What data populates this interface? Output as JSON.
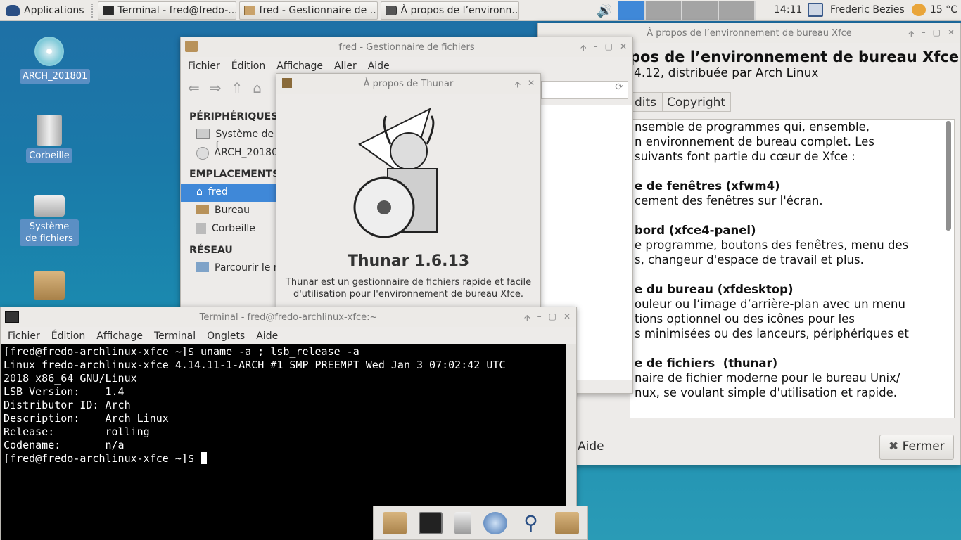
{
  "panel": {
    "applications_label": "Applications",
    "tasks": [
      {
        "label": "Terminal - fred@fredo-..."
      },
      {
        "label": "fred - Gestionnaire de ..."
      },
      {
        "label": "À propos de l’environn..."
      }
    ],
    "clock": "14:11",
    "user": "Frederic Bezies",
    "weather": "15 °C"
  },
  "desktop": {
    "icons": [
      {
        "label": "ARCH_201801"
      },
      {
        "label": "Corbeille"
      },
      {
        "label": "Système de fichiers"
      }
    ]
  },
  "xfce_about": {
    "title": "À propos de l’environnement de bureau Xfce",
    "heading": "pos de l’environnement de bureau Xfce",
    "subtitle": "4.12, distribuée par Arch Linux",
    "tabs": [
      "dits",
      "Copyright"
    ],
    "paragraphs": [
      {
        "bold": "",
        "text": "nsemble de programmes qui, ensemble,\nn environnement de bureau complet. Les\nsuivants font partie du cœur de Xfce :"
      },
      {
        "bold": "e de fenêtres (xfwm4)",
        "text": "cement des fenêtres sur l'écran."
      },
      {
        "bold": "bord (xfce4-panel)",
        "text": "e programme, boutons des fenêtres, menu des\ns, changeur d'espace de travail et plus."
      },
      {
        "bold": "e du bureau (xfdesktop)",
        "text": "ouleur ou l’image d’arrière-plan avec un menu\ntions optionnel ou des icônes pour les\ns minimisées ou des lanceurs, périphériques et"
      },
      {
        "bold": "e de fichiers  (thunar)",
        "text": "naire de fichier moderne pour le bureau Unix/\nnux, se voulant simple d'utilisation et rapide."
      }
    ],
    "help_label": "Aide",
    "close_label": "Fermer"
  },
  "filemanager": {
    "title": "fred - Gestionnaire de fichiers",
    "menu": [
      "Fichier",
      "Édition",
      "Affichage",
      "Aller",
      "Aide"
    ],
    "sections": [
      {
        "header": "PÉRIPHÉRIQUES",
        "items": [
          "Système de f",
          "ARCH_20180"
        ]
      },
      {
        "header": "EMPLACEMENTS",
        "items": [
          "fred",
          "Bureau",
          "Corbeille"
        ]
      },
      {
        "header": "RÉSEAU",
        "items": [
          "Parcourir le r"
        ]
      }
    ],
    "selected_item": "fred"
  },
  "thunar_about": {
    "title": "À propos de Thunar",
    "app_name": "Thunar 1.6.13",
    "description": "Thunar est un gestionnaire de fichiers rapide et facile\nd'utilisation pour l'environnement de bureau Xfce."
  },
  "terminal": {
    "title": "Terminal - fred@fredo-archlinux-xfce:~",
    "menu": [
      "Fichier",
      "Édition",
      "Affichage",
      "Terminal",
      "Onglets",
      "Aide"
    ],
    "lines": [
      "[fred@fredo-archlinux-xfce ~]$ uname -a ; lsb_release -a",
      "Linux fredo-archlinux-xfce 4.14.11-1-ARCH #1 SMP PREEMPT Wed Jan 3 07:02:42 UTC",
      "2018 x86_64 GNU/Linux",
      "LSB Version:    1.4",
      "Distributor ID: Arch",
      "Description:    Arch Linux",
      "Release:        rolling",
      "Codename:       n/a",
      "[fred@fredo-archlinux-xfce ~]$ "
    ]
  },
  "dock": {
    "items": [
      "home-folder-icon",
      "terminal-icon",
      "file-cabinet-icon",
      "web-browser-icon",
      "search-icon",
      "folder-icon"
    ]
  },
  "colors": {
    "selection": "#3f88d8",
    "panel": "#eceae7",
    "terminal_bg": "#000000"
  }
}
